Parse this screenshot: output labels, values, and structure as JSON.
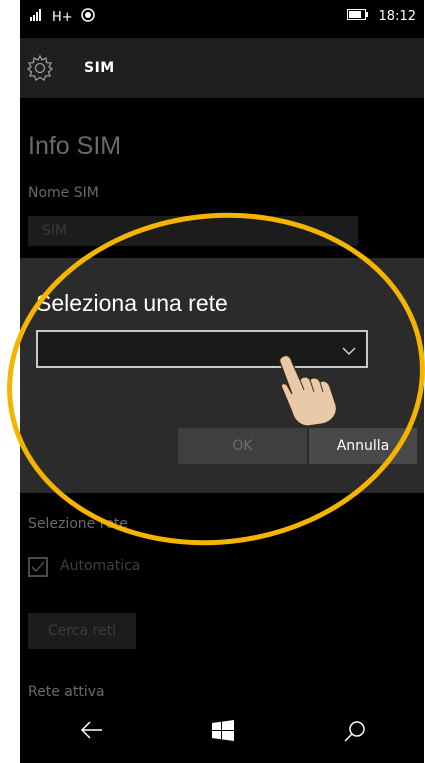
{
  "status_bar": {
    "network": "H+",
    "time": "18:12"
  },
  "header": {
    "title": "SIM",
    "icon": "gear-icon"
  },
  "page": {
    "heading": "Info SIM",
    "sim_name_label": "Nome SIM",
    "sim_name_value": "SIM",
    "network_selection_label": "Selezione rete",
    "automatic_label": "Automatica",
    "automatic_checked": true,
    "search_button": "Cerca reti",
    "active_network_label": "Rete attiva"
  },
  "dialog": {
    "title": "Seleziona una rete",
    "select_value": "",
    "ok_label": "OK",
    "cancel_label": "Annulla"
  },
  "navbar": {
    "icons": [
      "back-icon",
      "windows-start-icon",
      "search-icon"
    ]
  },
  "colors": {
    "highlight": "#f5b400",
    "background": "#000000",
    "dialog": "#2b2b2b"
  }
}
